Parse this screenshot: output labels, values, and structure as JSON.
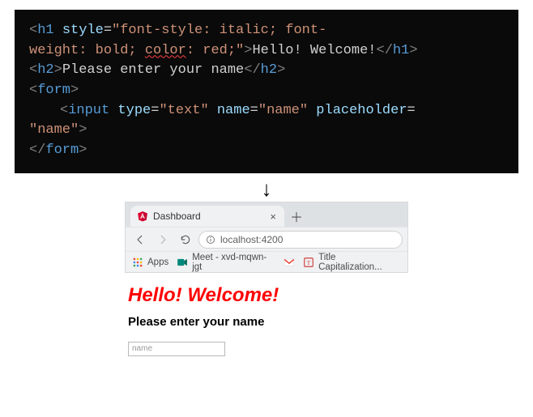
{
  "code": {
    "h1_open": "<h1",
    "h1_style_attr": "style",
    "h1_style_val_pre": "\"font-style: italic; font-\nweight: bold; ",
    "h1_style_color_word": "color",
    "h1_style_val_post": ": red;\"",
    "h1_text": "Hello! Welcome!",
    "h1_close": "</h1>",
    "h2_open": "<h2>",
    "h2_text": "Please enter your name",
    "h2_close": "</h2>",
    "form_open": "<form>",
    "input_open": "<input",
    "input_type_attr": "type",
    "input_type_val": "\"text\"",
    "input_name_attr": "name",
    "input_name_val": "\"name\"",
    "input_ph_attr": "placeholder",
    "input_ph_val": "\"name\"",
    "form_close": "</form>"
  },
  "browser": {
    "tab_title": "Dashboard",
    "url": "localhost:4200",
    "bookmarks": {
      "apps": "Apps",
      "meet": "Meet - xvd-mqwn-jgt",
      "titlecap": "Title Capitalization..."
    }
  },
  "rendered": {
    "h1": "Hello! Welcome!",
    "h2": "Please enter your name",
    "input_placeholder": "name"
  }
}
